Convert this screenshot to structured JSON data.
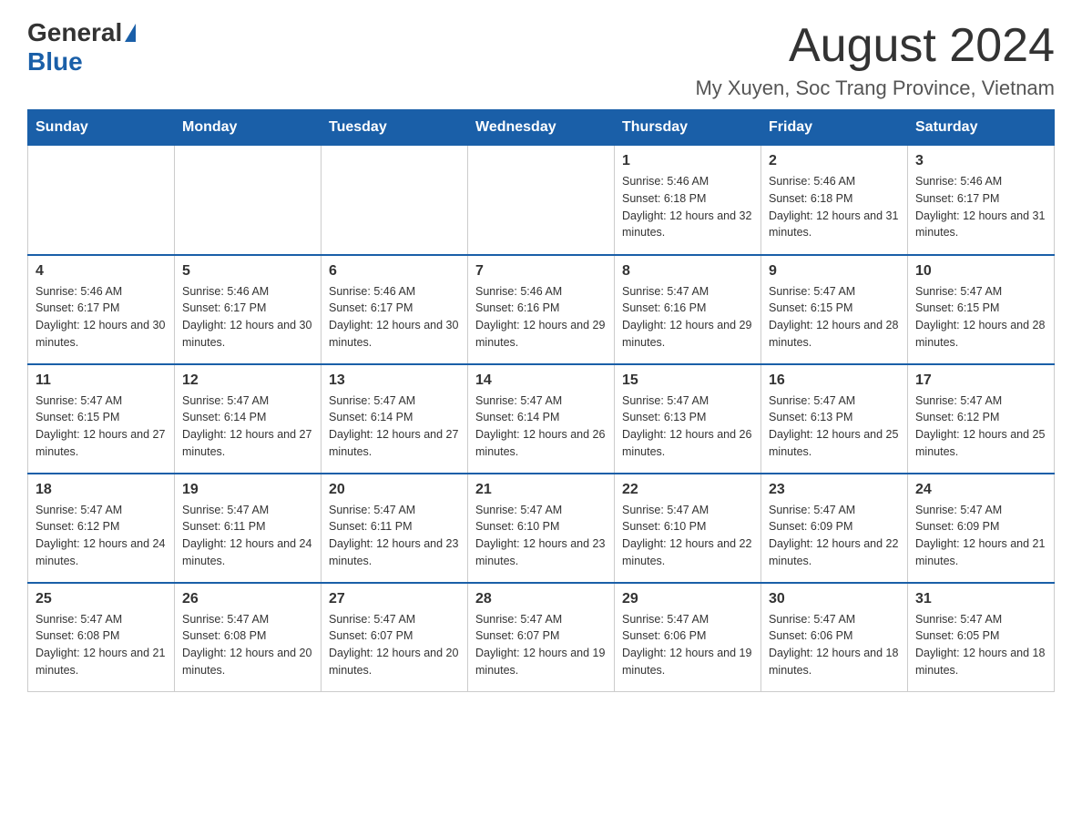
{
  "header": {
    "logo_general": "General",
    "logo_blue": "Blue",
    "month_year": "August 2024",
    "location": "My Xuyen, Soc Trang Province, Vietnam"
  },
  "days_of_week": [
    "Sunday",
    "Monday",
    "Tuesday",
    "Wednesday",
    "Thursday",
    "Friday",
    "Saturday"
  ],
  "weeks": [
    [
      {
        "day": "",
        "info": ""
      },
      {
        "day": "",
        "info": ""
      },
      {
        "day": "",
        "info": ""
      },
      {
        "day": "",
        "info": ""
      },
      {
        "day": "1",
        "info": "Sunrise: 5:46 AM\nSunset: 6:18 PM\nDaylight: 12 hours and 32 minutes."
      },
      {
        "day": "2",
        "info": "Sunrise: 5:46 AM\nSunset: 6:18 PM\nDaylight: 12 hours and 31 minutes."
      },
      {
        "day": "3",
        "info": "Sunrise: 5:46 AM\nSunset: 6:17 PM\nDaylight: 12 hours and 31 minutes."
      }
    ],
    [
      {
        "day": "4",
        "info": "Sunrise: 5:46 AM\nSunset: 6:17 PM\nDaylight: 12 hours and 30 minutes."
      },
      {
        "day": "5",
        "info": "Sunrise: 5:46 AM\nSunset: 6:17 PM\nDaylight: 12 hours and 30 minutes."
      },
      {
        "day": "6",
        "info": "Sunrise: 5:46 AM\nSunset: 6:17 PM\nDaylight: 12 hours and 30 minutes."
      },
      {
        "day": "7",
        "info": "Sunrise: 5:46 AM\nSunset: 6:16 PM\nDaylight: 12 hours and 29 minutes."
      },
      {
        "day": "8",
        "info": "Sunrise: 5:47 AM\nSunset: 6:16 PM\nDaylight: 12 hours and 29 minutes."
      },
      {
        "day": "9",
        "info": "Sunrise: 5:47 AM\nSunset: 6:15 PM\nDaylight: 12 hours and 28 minutes."
      },
      {
        "day": "10",
        "info": "Sunrise: 5:47 AM\nSunset: 6:15 PM\nDaylight: 12 hours and 28 minutes."
      }
    ],
    [
      {
        "day": "11",
        "info": "Sunrise: 5:47 AM\nSunset: 6:15 PM\nDaylight: 12 hours and 27 minutes."
      },
      {
        "day": "12",
        "info": "Sunrise: 5:47 AM\nSunset: 6:14 PM\nDaylight: 12 hours and 27 minutes."
      },
      {
        "day": "13",
        "info": "Sunrise: 5:47 AM\nSunset: 6:14 PM\nDaylight: 12 hours and 27 minutes."
      },
      {
        "day": "14",
        "info": "Sunrise: 5:47 AM\nSunset: 6:14 PM\nDaylight: 12 hours and 26 minutes."
      },
      {
        "day": "15",
        "info": "Sunrise: 5:47 AM\nSunset: 6:13 PM\nDaylight: 12 hours and 26 minutes."
      },
      {
        "day": "16",
        "info": "Sunrise: 5:47 AM\nSunset: 6:13 PM\nDaylight: 12 hours and 25 minutes."
      },
      {
        "day": "17",
        "info": "Sunrise: 5:47 AM\nSunset: 6:12 PM\nDaylight: 12 hours and 25 minutes."
      }
    ],
    [
      {
        "day": "18",
        "info": "Sunrise: 5:47 AM\nSunset: 6:12 PM\nDaylight: 12 hours and 24 minutes."
      },
      {
        "day": "19",
        "info": "Sunrise: 5:47 AM\nSunset: 6:11 PM\nDaylight: 12 hours and 24 minutes."
      },
      {
        "day": "20",
        "info": "Sunrise: 5:47 AM\nSunset: 6:11 PM\nDaylight: 12 hours and 23 minutes."
      },
      {
        "day": "21",
        "info": "Sunrise: 5:47 AM\nSunset: 6:10 PM\nDaylight: 12 hours and 23 minutes."
      },
      {
        "day": "22",
        "info": "Sunrise: 5:47 AM\nSunset: 6:10 PM\nDaylight: 12 hours and 22 minutes."
      },
      {
        "day": "23",
        "info": "Sunrise: 5:47 AM\nSunset: 6:09 PM\nDaylight: 12 hours and 22 minutes."
      },
      {
        "day": "24",
        "info": "Sunrise: 5:47 AM\nSunset: 6:09 PM\nDaylight: 12 hours and 21 minutes."
      }
    ],
    [
      {
        "day": "25",
        "info": "Sunrise: 5:47 AM\nSunset: 6:08 PM\nDaylight: 12 hours and 21 minutes."
      },
      {
        "day": "26",
        "info": "Sunrise: 5:47 AM\nSunset: 6:08 PM\nDaylight: 12 hours and 20 minutes."
      },
      {
        "day": "27",
        "info": "Sunrise: 5:47 AM\nSunset: 6:07 PM\nDaylight: 12 hours and 20 minutes."
      },
      {
        "day": "28",
        "info": "Sunrise: 5:47 AM\nSunset: 6:07 PM\nDaylight: 12 hours and 19 minutes."
      },
      {
        "day": "29",
        "info": "Sunrise: 5:47 AM\nSunset: 6:06 PM\nDaylight: 12 hours and 19 minutes."
      },
      {
        "day": "30",
        "info": "Sunrise: 5:47 AM\nSunset: 6:06 PM\nDaylight: 12 hours and 18 minutes."
      },
      {
        "day": "31",
        "info": "Sunrise: 5:47 AM\nSunset: 6:05 PM\nDaylight: 12 hours and 18 minutes."
      }
    ]
  ]
}
